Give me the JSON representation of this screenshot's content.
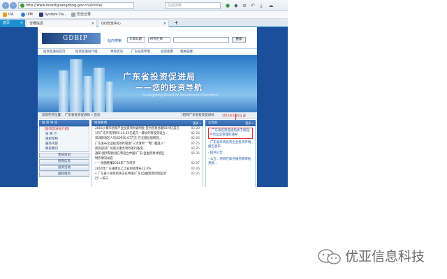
{
  "browser": {
    "url": "http://www.investguangdong.gov.cn/Article/",
    "search_placeholder": "在此搜索",
    "favorites": [
      {
        "label": "OA"
      },
      {
        "label": "IPM"
      },
      {
        "label": "System Da..."
      },
      {
        "label": "历史记录"
      }
    ],
    "tabs": [
      {
        "label": "首页",
        "active": true
      },
      {
        "label": "详细信息"
      },
      {
        "label": "QQ安全中心"
      }
    ],
    "new_tab_label": "+"
  },
  "site": {
    "logo_text": "GDBIP",
    "search_label": "站内搜索",
    "search_select1": "文章标题",
    "search_select2": "所有栏目",
    "search_button": "搜索",
    "menu": [
      "投资促进局首页",
      "投资促进局介绍",
      "本局资讯",
      "广东投资环境",
      "投资指南",
      "相关链接"
    ],
    "banner_title": "广东省投资促进局",
    "banner_subtitle": "——您的投资导航",
    "banner_en": "Guangdong Board of Investment Promotion",
    "breadcrumb": "您现在的位置： 广东省投资促进局 » 首页",
    "crumb_right": "[招商广东省投资促进局",
    "date_text": "2015年3月6日 星",
    "left_box_title": "投 资 导 览",
    "left_items": [
      {
        "label": "【投资促进局介绍】",
        "hd": true
      },
      {
        "label": "局 简 介"
      },
      {
        "label": "组织架构"
      },
      {
        "label": "服务内容"
      },
      {
        "label": "联系我们"
      }
    ],
    "left_buttons": [
      "本局资讯",
      "招商信息",
      "投资活动",
      "国际视点"
    ],
    "news_title": "招商新闻",
    "news_more": "更多 »",
    "news": [
      {
        "title": "2015十堰市招商产业投资项目说明会 签约项目总额59.9亿美元",
        "date": "02-28"
      },
      {
        "title": "1月广东外资项目5.19.33亿美元一增加外商投资设立...",
        "date": "02-26"
      },
      {
        "title": "深圳前海区人均GDP30.07万元 在全国位居榜首...",
        "date": "02-26"
      },
      {
        "title": "广东发布企业投资项目管理“三大清单” “零门槛准入”",
        "date": "02-25"
      },
      {
        "title": "商务部对广州南沙重大项目进行备案...",
        "date": "02-25"
      },
      {
        "title": "通知:国务院批准在粤设立中国(广东)自由贸易试验区",
        "date": "02-25"
      },
      {
        "title": "制作情况动态",
        "date": ""
      },
      {
        "title": "• 一张图看懂2014年广东经济",
        "date": "02-27"
      },
      {
        "title": "2014年广东规模以上工业利润增长12.6%",
        "date": "02-26"
      },
      {
        "title": "• 广东省人民政府关于在中国(广东)自由贸易试验区试",
        "date": "02-25"
      },
      {
        "title": "行“一照三",
        "date": ""
      }
    ],
    "notice_title": "公告栏",
    "notice_more": "更多 »",
    "notices": [
      {
        "label": "· 广东省投资促进局关于加强外资企业管理的通知",
        "hl": true
      },
      {
        "label": "· 广东省外商投资企业投资环境报告发布"
      },
      {
        "label": "· 招商公告"
      },
      {
        "label": "· 公告：项目在政务服务网审批系统..."
      }
    ]
  },
  "watermark": {
    "text": "优亚信息科技"
  },
  "colors": {
    "page_bg": "#1a4f9c",
    "accent": "#1e8fd0",
    "highlight": "#e03030"
  }
}
